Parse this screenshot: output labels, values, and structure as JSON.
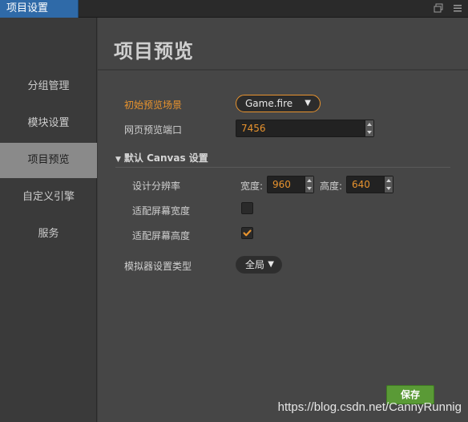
{
  "window": {
    "tab_title": "项目设置"
  },
  "sidebar": {
    "items": [
      {
        "label": "分组管理"
      },
      {
        "label": "模块设置"
      },
      {
        "label": "项目预览"
      },
      {
        "label": "自定义引擎"
      },
      {
        "label": "服务"
      }
    ],
    "active_index": 2
  },
  "main": {
    "title": "项目预览",
    "initial_scene_label": "初始预览场景",
    "initial_scene_value": "Game.fire",
    "port_label": "网页预览端口",
    "port_value": "7456",
    "section_title": "默认 Canvas 设置",
    "resolution_label": "设计分辨率",
    "width_label": "宽度:",
    "width_value": "960",
    "height_label": "高度:",
    "height_value": "640",
    "fit_width_label": "适配屏幕宽度",
    "fit_width_checked": false,
    "fit_height_label": "适配屏幕高度",
    "fit_height_checked": true,
    "simulator_label": "模拟器设置类型",
    "simulator_value": "全局",
    "save_label": "保存"
  },
  "watermark": "https://blog.csdn.net/CannyRunnig",
  "colors": {
    "accent": "#e8932e",
    "tab_blue": "#2f6aa8",
    "save_green": "#5a9a36",
    "active_item": "#8a8a8a"
  }
}
